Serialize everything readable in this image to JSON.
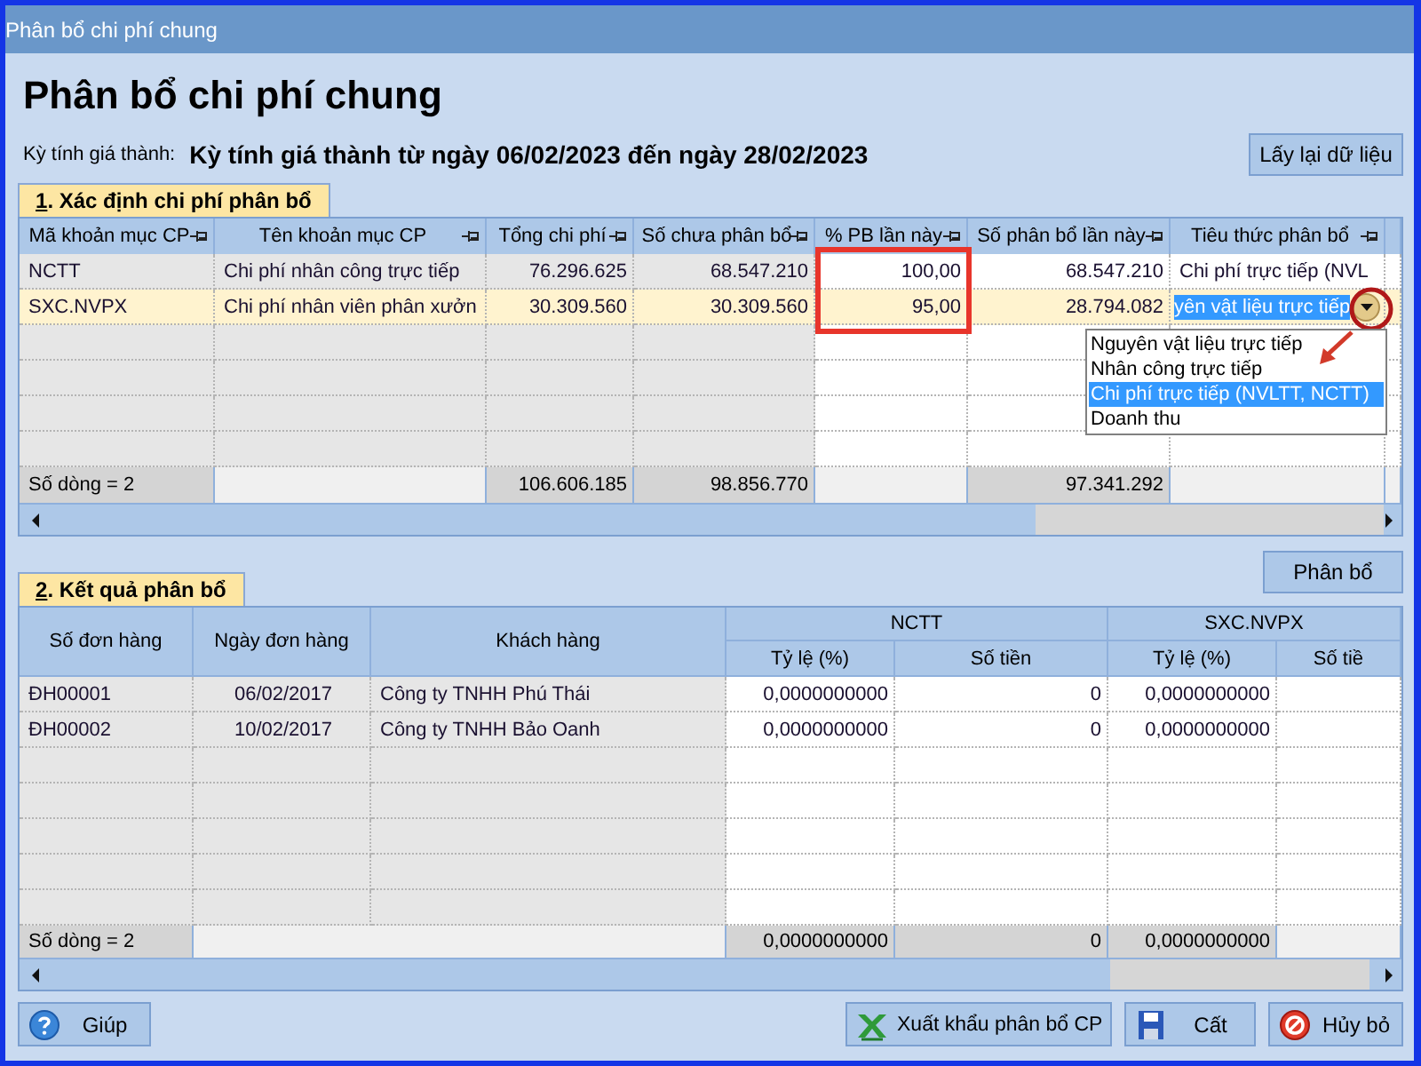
{
  "window": {
    "title": "Phân bổ chi phí chung"
  },
  "heading": "Phân bổ chi phí chung",
  "period": {
    "label": "Kỳ tính giá thành:",
    "value": "Kỳ tính giá thành từ ngày 06/02/2023 đến ngày 28/02/2023"
  },
  "reload_button": "Lấy lại dữ liệu",
  "allocation_section": {
    "tab": {
      "hotkey": "1",
      "label": ". Xác định chi phí phân bổ"
    },
    "table": {
      "columns": [
        {
          "label": "Mã khoản mục CP",
          "pinned": true,
          "kind": "text",
          "readonly": true
        },
        {
          "label": "Tên khoản mục CP",
          "pinned": true,
          "kind": "text",
          "readonly": true
        },
        {
          "label": "Tổng chi phí",
          "pinned": true,
          "kind": "number",
          "readonly": true
        },
        {
          "label": "Số chưa phân bổ",
          "pinned": true,
          "kind": "number",
          "readonly": true
        },
        {
          "label": "% PB lần này",
          "pinned": true,
          "kind": "number",
          "readonly": false
        },
        {
          "label": "Số phân bổ lần này",
          "pinned": true,
          "kind": "number",
          "readonly": false
        },
        {
          "label": "Tiêu thức phân bổ",
          "pinned": true,
          "kind": "combo",
          "readonly": false
        },
        {
          "pinned": false,
          "kind": "text",
          "readonly": false
        }
      ],
      "rows": [
        {
          "selected": false,
          "editing": false,
          "cells": [
            "NCTT",
            "Chi phí nhân công trực tiếp",
            "76.296.625",
            "68.547.210",
            "100,00",
            "68.547.210",
            "Chi phí trực tiếp (NVL"
          ]
        },
        {
          "selected": true,
          "editing": true,
          "cells": [
            "SXC.NVPX",
            "Chi phí nhân viên phân xưởn",
            "30.309.560",
            "30.309.560",
            "95,00",
            "28.794.082",
            "yên vật liệu trực tiếp"
          ]
        }
      ],
      "footer": [
        {
          "text": "Số dòng = 2"
        },
        {
          "kind": "blank"
        },
        {
          "text": "106.606.185"
        },
        {
          "text": "98.856.770"
        },
        {
          "kind": "blank"
        },
        {
          "text": "97.341.292"
        },
        {
          "kind": "blank"
        },
        {
          "kind": "blank"
        }
      ],
      "dropdown": {
        "options": [
          {
            "label": "Nguyên vật liệu trực tiếp",
            "selected": false
          },
          {
            "label": "Nhân công trực tiếp",
            "selected": false
          },
          {
            "label": "Chi phí trực tiếp (NVLTT, NCTT)",
            "selected": true
          },
          {
            "label": "Doanh thu",
            "selected": false
          }
        ]
      }
    }
  },
  "result_section": {
    "tab": {
      "hotkey": "2",
      "label": ". Kết quả phân bổ"
    },
    "allocate_button": "Phân bổ",
    "table": {
      "column_groups": [
        {
          "label": "NCTT"
        },
        {
          "label": "SXC.NVPX"
        }
      ],
      "columns": [
        {
          "label": "Số đơn hàng",
          "kind": "text"
        },
        {
          "label": "Ngày đơn hàng",
          "kind": "center"
        },
        {
          "label": "Khách hàng",
          "kind": "text"
        },
        {
          "label": "Tỷ lệ (%)",
          "kind": "grouped"
        },
        {
          "label": "Số tiền",
          "kind": "grouped"
        },
        {
          "label": "Tỷ lệ (%)",
          "kind": "grouped"
        },
        {
          "label": "Số tiề",
          "kind": "grouped"
        }
      ],
      "rows": [
        {
          "cells": [
            "ĐH00001",
            "06/02/2017",
            "Công ty TNHH Phú Thái",
            "0,0000000000",
            "0",
            "0,0000000000"
          ]
        },
        {
          "cells": [
            "ĐH00002",
            "10/02/2017",
            "Công ty TNHH Bảo Oanh",
            "0,0000000000",
            "0",
            "0,0000000000"
          ]
        }
      ],
      "footer": [
        {
          "text": "Số dòng = 2"
        },
        {
          "kind": "wide_blank"
        },
        {
          "text": "0,0000000000"
        },
        {
          "text": "0"
        },
        {
          "text": "0,0000000000"
        },
        {
          "kind": "blank"
        }
      ]
    }
  },
  "buttons_left": [
    {
      "label": "Giúp",
      "kind": "help"
    }
  ],
  "buttons_right": [
    {
      "label": "Xuất khẩu phân bổ CP",
      "kind": "excel"
    },
    {
      "label": "Cất",
      "kind": "save"
    },
    {
      "label": "Hủy bỏ",
      "kind": "cancel"
    }
  ]
}
